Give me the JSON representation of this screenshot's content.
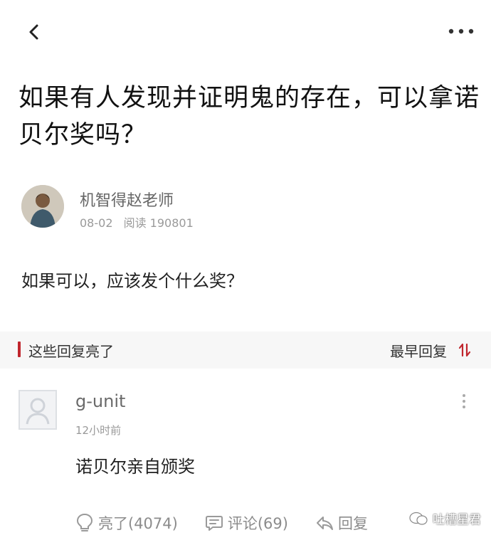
{
  "header": {
    "back_icon": "chevron-left-icon",
    "more_icon": "more-horizontal-icon"
  },
  "post": {
    "title": "如果有人发现并证明鬼的存在，可以拿诺贝尔奖吗？",
    "author_name": "机智得赵老师",
    "date": "08-02",
    "read_label": "阅读 190801",
    "question": "如果可以，应该发个什么奖？"
  },
  "replies_section": {
    "title": "这些回复亮了",
    "sort_label": "最早回复",
    "accent_color": "#c0262d"
  },
  "reply": {
    "username": "g-unit",
    "time": "12小时前",
    "content": "诺贝尔亲自颁奖",
    "actions": {
      "light_label": "亮了(4074)",
      "comment_label": "评论(69)",
      "reply_label": "回复"
    }
  },
  "watermark": {
    "text": "吐槽星君"
  }
}
